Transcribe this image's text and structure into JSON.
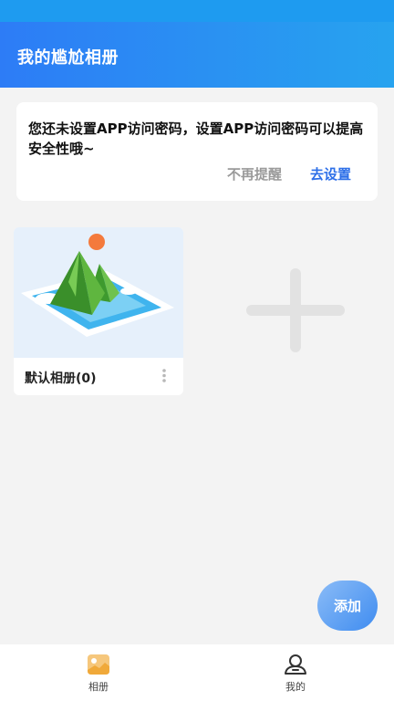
{
  "header": {
    "title": "我的尴尬相册"
  },
  "notice": {
    "message": "您还未设置APP访问密码，设置APP访问密码可以提高安全性哦~",
    "dismiss_label": "不再提醒",
    "action_label": "去设置"
  },
  "albums": [
    {
      "name": "默认相册(0)"
    }
  ],
  "fab": {
    "label": "添加"
  },
  "tabbar": {
    "items": [
      {
        "label": "相册",
        "icon": "album-icon"
      },
      {
        "label": "我的",
        "icon": "profile-icon"
      }
    ]
  },
  "colors": {
    "header_start": "#2d7cf6",
    "header_end": "#27a3ef",
    "action": "#2d6fe8",
    "background": "#f3f3f3"
  }
}
